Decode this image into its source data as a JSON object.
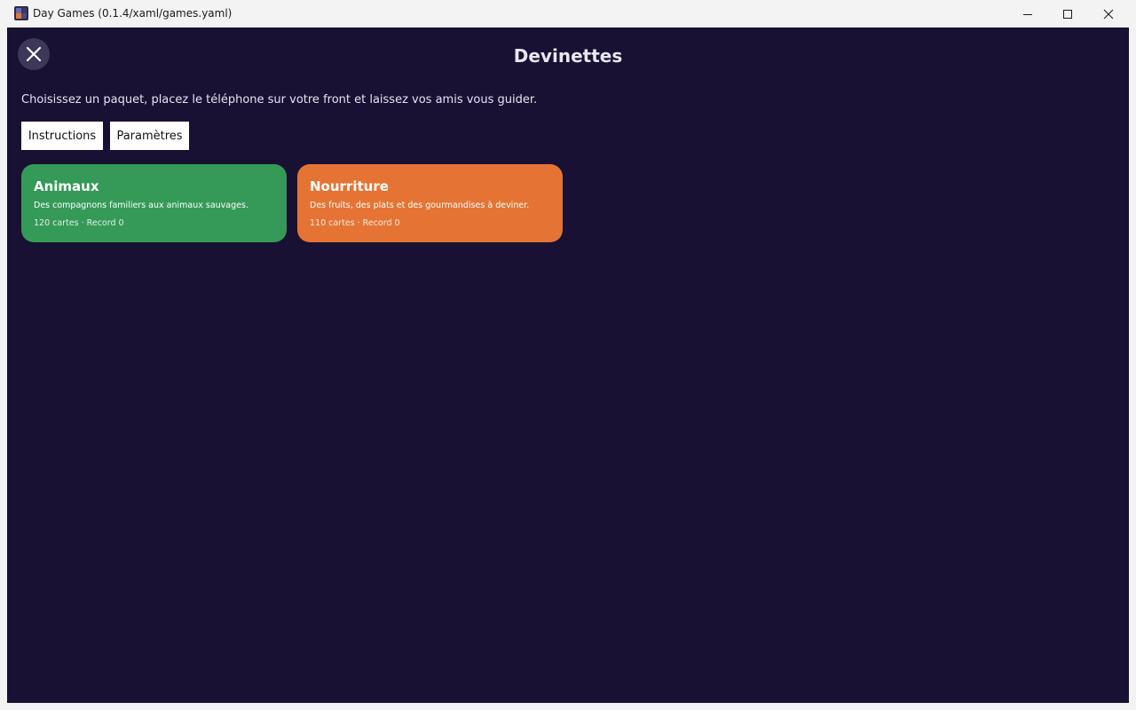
{
  "window": {
    "title": "Day Games (0.1.4/xaml/games.yaml)",
    "icon": "app-grid-icon"
  },
  "header": {
    "title": "Devinettes",
    "close_icon": "close-icon"
  },
  "intro": {
    "text": "Choisissez un paquet, placez le téléphone sur votre front et laissez vos amis vous guider."
  },
  "actions": {
    "instructions_label": "Instructions",
    "settings_label": "Paramètres"
  },
  "decks": [
    {
      "name": "Animaux",
      "description": "Des compagnons familiers aux animaux sauvages.",
      "meta": "120 cartes · Record 0",
      "color": "#359a57"
    },
    {
      "name": "Nourriture",
      "description": "Des fruits, des plats et des gourmandises à deviner.",
      "meta": "110 cartes · Record 0",
      "color": "#e57434"
    }
  ],
  "colors": {
    "background": "#181133",
    "title_bar": "#f3f3f3",
    "close_button": "#3d3858"
  }
}
